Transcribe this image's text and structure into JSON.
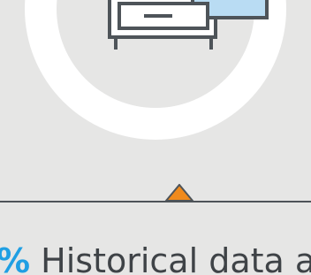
{
  "caption": {
    "percent_sign": "%",
    "text": " Historical data an"
  },
  "colors": {
    "background": "#e6e6e5",
    "ring": "#ffffff",
    "line": "#4e5459",
    "marker": "#f08a1c",
    "accent": "#1f9fe3",
    "text": "#3f4347",
    "cabinet_fill": "#ffffff",
    "cabinet_panel": "#b9dcf3"
  },
  "icons": {
    "illustration": "file-cabinet-icon",
    "marker": "triangle-marker-icon"
  }
}
